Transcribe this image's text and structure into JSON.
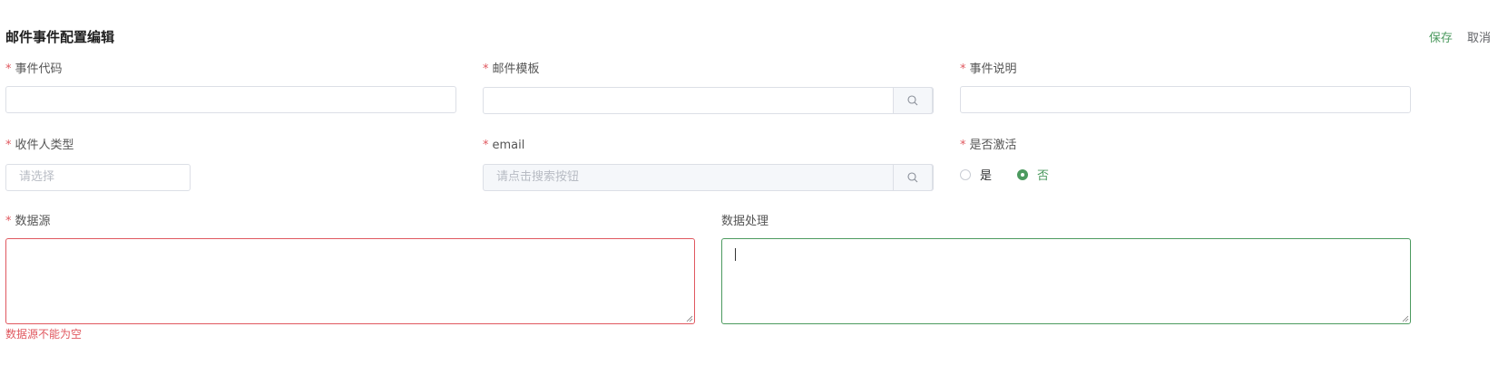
{
  "header": {
    "title": "邮件事件配置编辑",
    "save_label": "保存",
    "cancel_label": "取消"
  },
  "fields": {
    "event_code": {
      "label": "事件代码",
      "value": ""
    },
    "mail_template": {
      "label": "邮件模板",
      "value": ""
    },
    "event_desc": {
      "label": "事件说明",
      "value": ""
    },
    "recipient_type": {
      "label": "收件人类型",
      "placeholder": "请选择"
    },
    "email": {
      "label": "email",
      "placeholder": "请点击搜索按钮"
    },
    "is_active": {
      "label": "是否激活",
      "options": [
        "是",
        "否"
      ],
      "selected": "否"
    },
    "data_source": {
      "label": "数据源",
      "value": "",
      "error": "数据源不能为空"
    },
    "data_processing": {
      "label": "数据处理",
      "value": ""
    }
  },
  "required_mark": "*",
  "colors": {
    "accent": "#4c9a5f",
    "error": "#e0585f",
    "border": "#dcdfe6"
  },
  "icons": {
    "search": "search-icon",
    "resize": "resize-handle-icon"
  }
}
